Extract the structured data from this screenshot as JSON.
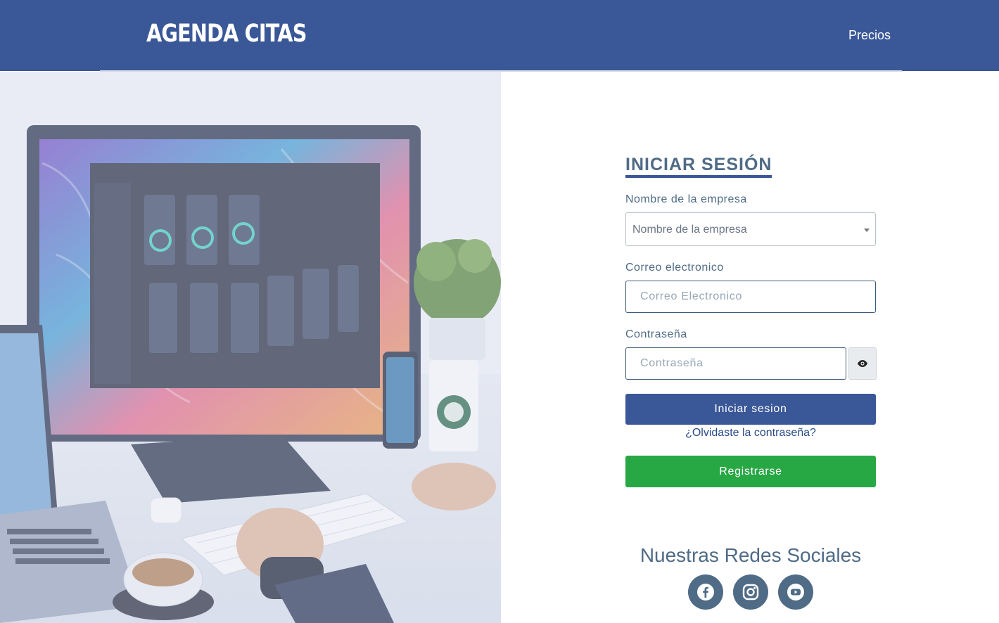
{
  "header": {
    "brand": "AGENDA CITAS",
    "nav_precios": "Precios"
  },
  "hero": {
    "image": "desk-workspace-illustration"
  },
  "login": {
    "title": "INICIAR SESIÓN",
    "company_label": "Nombre de la empresa",
    "company_select_value": "Nombre de la empresa",
    "email_label": "Correo electronico",
    "email_placeholder": "Correo Electronico",
    "password_label": "Contraseña",
    "password_placeholder": "Contraseña",
    "show_password_icon": "eye-icon",
    "submit_label": "Iniciar sesion",
    "forgot_label": "¿Olvidaste la contraseña?",
    "register_label": "Registrarse"
  },
  "social": {
    "title": "Nuestras Redes Sociales",
    "icons": [
      "facebook-icon",
      "instagram-icon",
      "youtube-icon"
    ]
  },
  "colors": {
    "primary": "#3a5797",
    "success": "#28a745",
    "text": "#4f6b86"
  }
}
